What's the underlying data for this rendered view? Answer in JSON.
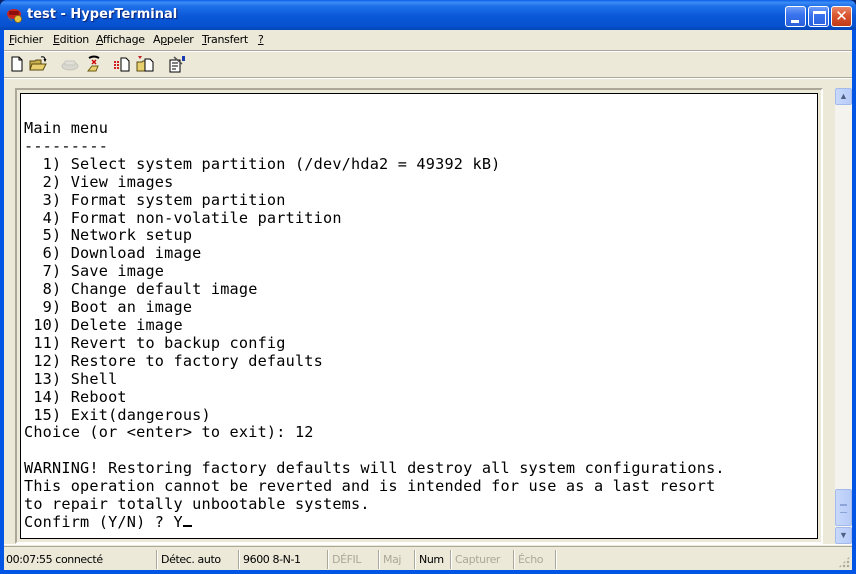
{
  "window": {
    "title": "test - HyperTerminal",
    "controls": {
      "minimize": "minimize",
      "maximize": "maximize",
      "close": "close"
    }
  },
  "menubar": {
    "items": [
      {
        "label": "Fichier",
        "mnemonic": "F"
      },
      {
        "label": "Edition",
        "mnemonic": "E"
      },
      {
        "label": "Affichage",
        "mnemonic": "A"
      },
      {
        "label": "Appeler",
        "mnemonic": "p"
      },
      {
        "label": "Transfert",
        "mnemonic": "T"
      },
      {
        "label": "?",
        "mnemonic": "?"
      }
    ]
  },
  "toolbar": {
    "buttons": [
      {
        "icon": "new-document-icon",
        "enabled": true
      },
      {
        "icon": "open-folder-icon",
        "enabled": true
      },
      {
        "icon": "call-phone-icon",
        "enabled": false
      },
      {
        "icon": "disconnect-phone-icon",
        "enabled": true
      },
      {
        "icon": "send-file-icon",
        "enabled": true
      },
      {
        "icon": "receive-file-icon",
        "enabled": true
      },
      {
        "icon": "properties-icon",
        "enabled": true
      }
    ]
  },
  "terminal": {
    "lines": [
      "Main menu",
      "---------",
      "  1) Select system partition (/dev/hda2 = 49392 kB)",
      "  2) View images",
      "  3) Format system partition",
      "  4) Format non-volatile partition",
      "  5) Network setup",
      "  6) Download image",
      "  7) Save image",
      "  8) Change default image",
      "  9) Boot an image",
      " 10) Delete image",
      " 11) Revert to backup config",
      " 12) Restore to factory defaults",
      " 13) Shell",
      " 14) Reboot",
      " 15) Exit(dangerous)",
      "Choice (or <enter> to exit): 12",
      "",
      "WARNING! Restoring factory defaults will destroy all system configurations.",
      "This operation cannot be reverted and is intended for use as a last resort",
      "to repair totally unbootable systems."
    ],
    "prompt": "Confirm (Y/N) ? Y"
  },
  "statusbar": {
    "connection": "00:07:55 connecté",
    "detection": "Détec. auto",
    "settings": "9600 8-N-1",
    "scroll": "DÉFIL",
    "caps": "Maj",
    "num": "Num",
    "capture": "Capturer",
    "echo": "Écho"
  }
}
